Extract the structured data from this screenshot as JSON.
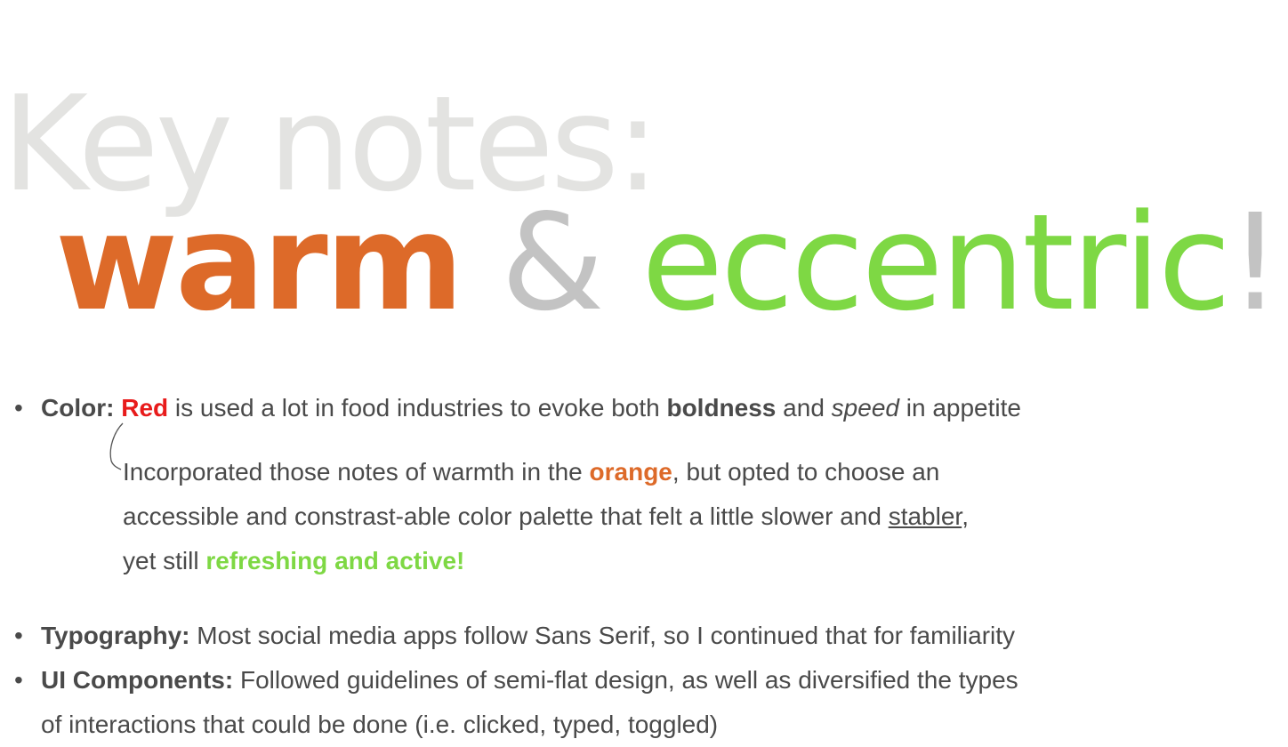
{
  "headline": {
    "key_notes": "Key notes:",
    "warm": "warm",
    "amp": "&",
    "eccentric": "eccentric",
    "bang": "!"
  },
  "color_bullet": {
    "label": "Color:",
    "red": "Red",
    "text1": " is used a lot in food industries to evoke both ",
    "boldness": "boldness",
    "text2": " and ",
    "speed": "speed",
    "text3": " in appetite"
  },
  "color_note": {
    "line1_a": "Incorporated those notes of warmth in the ",
    "line1_orange": "orange",
    "line1_b": ", but opted to choose an",
    "line2_a": "accessible and constrast-able color palette that felt a little slower and ",
    "line2_stabler": "stabler",
    "line2_b": ",",
    "line3_a": "yet still ",
    "line3_green": "refreshing and active!"
  },
  "typography_bullet": {
    "label": "Typography:",
    "text": " Most social media apps follow Sans Serif, so I continued that for familiarity"
  },
  "ui_bullet": {
    "label": "UI Components:",
    "line1": " Followed guidelines of semi-flat design, as well as diversified the types",
    "line2": "of interactions that could be done (i.e. clicked, typed, toggled)"
  },
  "bullet_char": "•",
  "colors": {
    "red": "#e81b1b",
    "orange": "#dd6a29",
    "green": "#7ed844",
    "grey_light": "#e3e3e1",
    "grey_mid": "#c3c3c3",
    "text": "#4a4a4a"
  }
}
